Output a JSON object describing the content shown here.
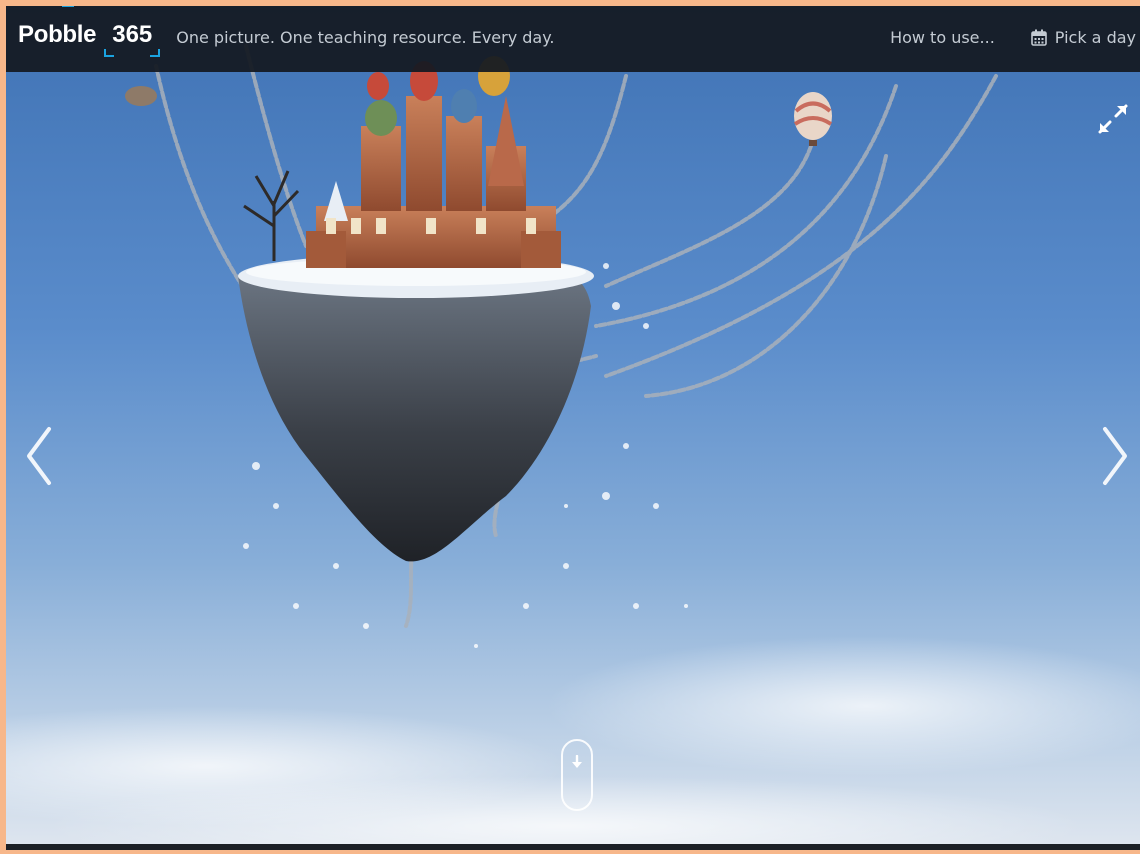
{
  "header": {
    "logo_word": "Pobble",
    "logo_number": "365",
    "tagline": "One picture. One teaching resource. Every day.",
    "nav": {
      "how_to_use": "How to use...",
      "pick_a_day": "Pick a day"
    }
  },
  "icons": {
    "calendar": "calendar-icon",
    "prev": "chevron-left-icon",
    "next": "chevron-right-icon",
    "fullscreen": "expand-icon",
    "scroll": "arrow-down-icon"
  },
  "colors": {
    "topbar": "#141a22",
    "accent": "#1aa3e0",
    "nav_text": "#c4cbd3",
    "page_border": "#f7b78a"
  }
}
